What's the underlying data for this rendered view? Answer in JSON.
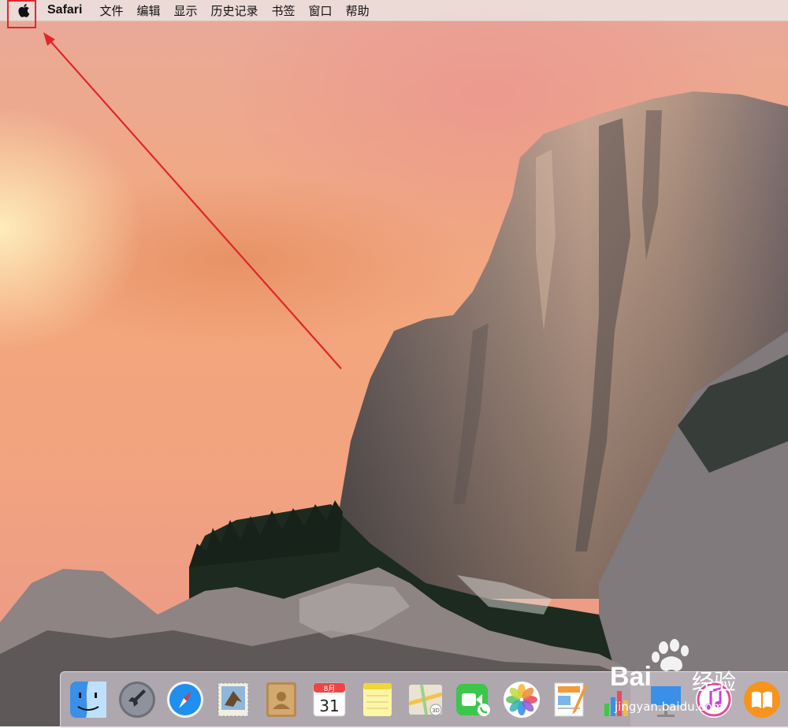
{
  "menubar": {
    "apple_icon": "apple-logo-icon",
    "app_name": "Safari",
    "items": [
      "文件",
      "编辑",
      "显示",
      "历史记录",
      "书签",
      "窗口",
      "帮助"
    ]
  },
  "annotation": {
    "highlight_color": "#e0262a",
    "arrow_color": "#e0262a"
  },
  "dock": {
    "icons": [
      "finder-icon",
      "launchpad-icon",
      "safari-icon",
      "mail-icon",
      "contacts-icon",
      "calendar-icon",
      "notes-icon",
      "maps-icon",
      "facetime-icon",
      "photos-icon",
      "pages-icon",
      "numbers-icon",
      "keynote-icon",
      "itunes-icon",
      "ibooks-icon"
    ],
    "calendar_month": "8月",
    "calendar_day": "31"
  },
  "watermark": {
    "brand": "Bai",
    "brand_suffix": "经验",
    "url": "jingyan.baidu.com"
  }
}
